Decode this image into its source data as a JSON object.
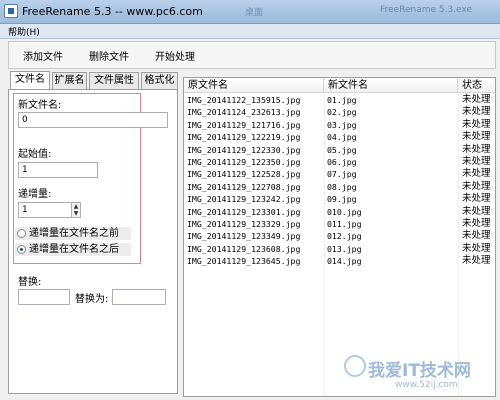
{
  "window": {
    "title": "FreeRename 5.3   --   www.pc6.com",
    "bg_title": "FreeRename 5.3.exe",
    "bg_title2": "桌面"
  },
  "menu": {
    "help": "帮助(H)"
  },
  "toolbar": {
    "add": "添加文件",
    "delete": "删除文件",
    "start": "开始处理"
  },
  "tabs": [
    "文件名",
    "扩展名",
    "文件属性",
    "格式化"
  ],
  "form": {
    "new_name_label": "新文件名:",
    "new_name_value": "0",
    "start_label": "起始值:",
    "start_value": "1",
    "step_label": "递增量:",
    "step_value": "1",
    "radio_before": "递增量在文件名之前",
    "radio_after": "递增量在文件名之后",
    "replace_label": "替换:",
    "replace_with_label": "替换为:"
  },
  "table": {
    "headers": [
      "原文件名",
      "新文件名",
      "状态"
    ],
    "rows": [
      [
        "IMG_20141122_135915.jpg",
        "01.jpg",
        "未处理"
      ],
      [
        "IMG_20141124_232613.jpg",
        "02.jpg",
        "未处理"
      ],
      [
        "IMG_20141129_121716.jpg",
        "03.jpg",
        "未处理"
      ],
      [
        "IMG_20141129_122219.jpg",
        "04.jpg",
        "未处理"
      ],
      [
        "IMG_20141129_122330.jpg",
        "05.jpg",
        "未处理"
      ],
      [
        "IMG_20141129_122350.jpg",
        "06.jpg",
        "未处理"
      ],
      [
        "IMG_20141129_122528.jpg",
        "07.jpg",
        "未处理"
      ],
      [
        "IMG_20141129_122708.jpg",
        "08.jpg",
        "未处理"
      ],
      [
        "IMG_20141129_123242.jpg",
        "09.jpg",
        "未处理"
      ],
      [
        "IMG_20141129_123301.jpg",
        "010.jpg",
        "未处理"
      ],
      [
        "IMG_20141129_123329.jpg",
        "011.jpg",
        "未处理"
      ],
      [
        "IMG_20141129_123349.jpg",
        "012.jpg",
        "未处理"
      ],
      [
        "IMG_20141129_123608.jpg",
        "013.jpg",
        "未处理"
      ],
      [
        "IMG_20141129_123645.jpg",
        "014.jpg",
        "未处理"
      ]
    ]
  },
  "watermark": {
    "text": "我爱IT技术网",
    "url": "www.52ij.com"
  }
}
